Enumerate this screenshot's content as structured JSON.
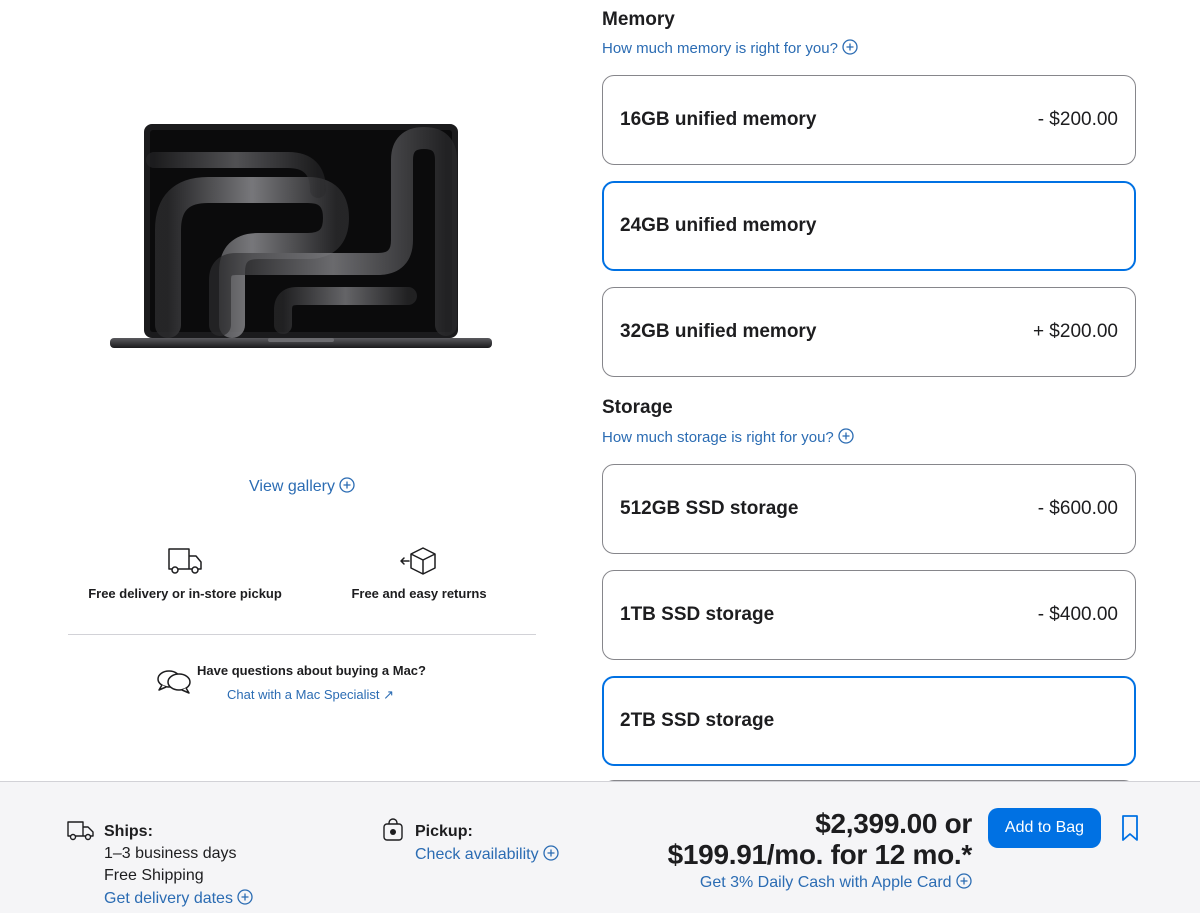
{
  "gallery": {
    "label": "View gallery"
  },
  "perks": {
    "delivery": "Free delivery or in-store pickup",
    "returns": "Free and easy returns"
  },
  "help": {
    "question": "Have questions about buying a Mac?",
    "chat_link": "Chat with a Mac Specialist ↗"
  },
  "memory": {
    "title": "Memory",
    "help_link": "How much memory is right for you?",
    "options": [
      {
        "label": "16GB unified memory",
        "price": "- $200.00",
        "selected": false
      },
      {
        "label": "24GB unified memory",
        "price": "",
        "selected": true
      },
      {
        "label": "32GB unified memory",
        "price": "+ $200.00",
        "selected": false
      }
    ]
  },
  "storage": {
    "title": "Storage",
    "help_link": "How much storage is right for you?",
    "options": [
      {
        "label": "512GB SSD storage",
        "price": "- $600.00",
        "selected": false
      },
      {
        "label": "1TB SSD storage",
        "price": "- $400.00",
        "selected": false
      },
      {
        "label": "2TB SSD storage",
        "price": "",
        "selected": true
      }
    ]
  },
  "shipping": {
    "title": "Ships:",
    "time": "1–3 business days",
    "method": "Free Shipping",
    "dates_link": "Get delivery dates"
  },
  "pickup": {
    "title": "Pickup:",
    "link": "Check availability"
  },
  "price": {
    "total": "$2,399.00 or",
    "monthly": "$199.91/mo. for 12 mo.*",
    "cash_link": "Get 3% Daily Cash with Apple Card"
  },
  "actions": {
    "add_to_bag": "Add to Bag"
  },
  "colors": {
    "accent": "#0071e3",
    "link": "#2b6cb3",
    "bar_bg": "#f5f5f7"
  },
  "icons": [
    "truck-icon",
    "box-return-icon",
    "chat-bubbles-icon",
    "bag-icon",
    "bookmark-icon",
    "plus-circle-icon"
  ]
}
